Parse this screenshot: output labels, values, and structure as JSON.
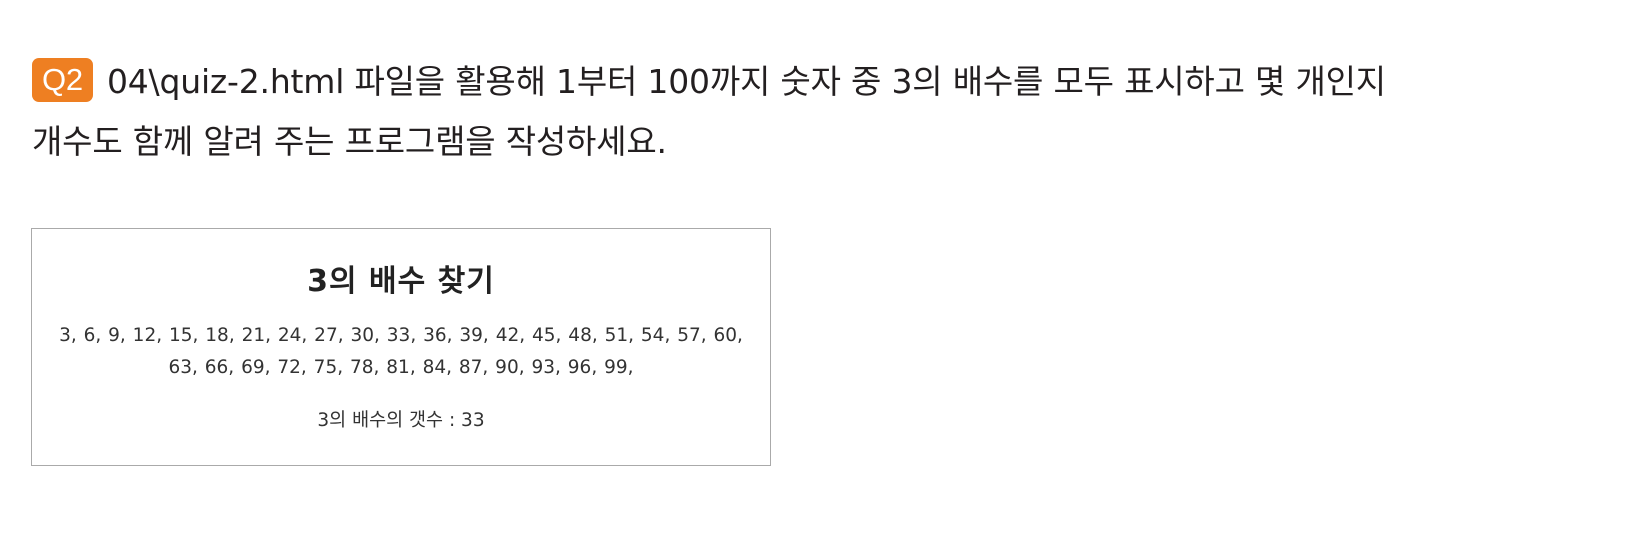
{
  "question": {
    "badge": "Q2",
    "line1": "04\\quiz-2.html 파일을 활용해 1부터 100까지 숫자 중 3의 배수를 모두 표시하고 몇 개인지",
    "line2": "개수도 함께 알려 주는 프로그램을 작성하세요."
  },
  "result": {
    "title": "3의 배수 찾기",
    "list_line1": "3, 6, 9, 12, 15, 18, 21, 24, 27, 30, 33, 36, 39, 42, 45, 48, 51, 54, 57, 60,",
    "list_line2": "63, 66, 69, 72, 75, 78, 81, 84, 87, 90, 93, 96, 99,",
    "count_text": "3의 배수의 갯수 : 33"
  },
  "colors": {
    "badge_background": "#ee7f22",
    "box_border": "#aaaaaa"
  }
}
